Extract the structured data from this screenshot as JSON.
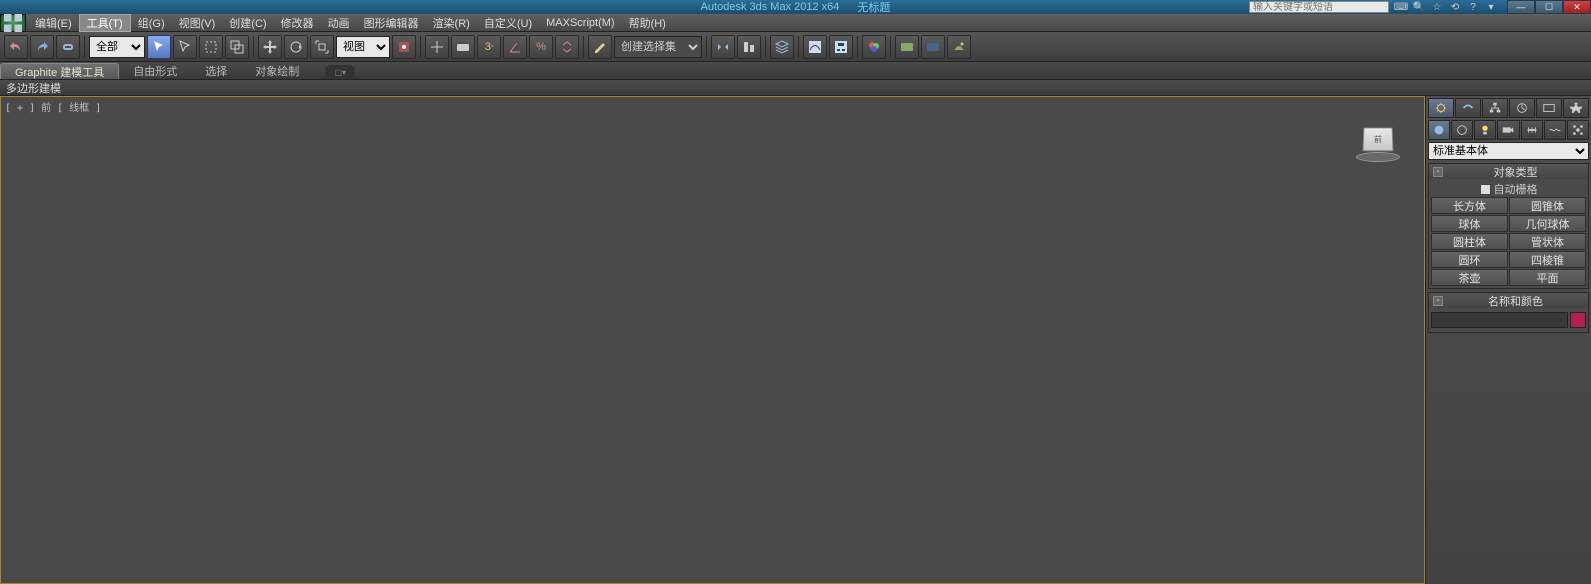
{
  "title": {
    "app": "Autodesk 3ds Max  2012 x64",
    "doc": "无标题"
  },
  "search_placeholder": "输入关键字或短语",
  "menus": [
    "编辑(E)",
    "工具(T)",
    "组(G)",
    "视图(V)",
    "创建(C)",
    "修改器",
    "动画",
    "图形编辑器",
    "渲染(R)",
    "自定义(U)",
    "MAXScript(M)",
    "帮助(H)"
  ],
  "toolbar": {
    "sel_all": "全部",
    "sel_view": "视图",
    "named_sel": "创建选择集"
  },
  "ribbon": {
    "tabs": [
      "Graphite 建模工具",
      "自由形式",
      "选择",
      "对象绘制"
    ],
    "sub": "多边形建模"
  },
  "viewport_label": "[ + ] 前 [ 线框 ]",
  "viewcube": "前",
  "panel": {
    "category": "标准基本体",
    "ro1_title": "对象类型",
    "autogrid": "自动栅格",
    "buttons": [
      "长方体",
      "圆锥体",
      "球体",
      "几何球体",
      "圆柱体",
      "管状体",
      "圆环",
      "四棱锥",
      "茶壶",
      "平面"
    ],
    "ro2_title": "名称和颜色"
  }
}
